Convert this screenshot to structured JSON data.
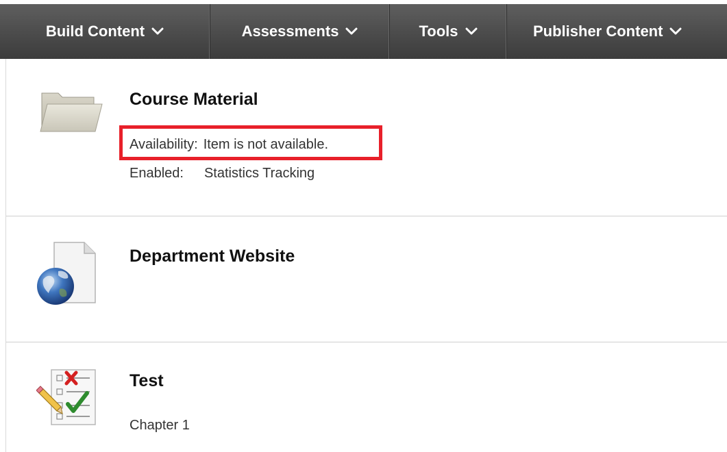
{
  "toolbar": {
    "items": [
      {
        "label": "Build Content"
      },
      {
        "label": "Assessments"
      },
      {
        "label": "Tools"
      },
      {
        "label": "Publisher Content"
      }
    ]
  },
  "content_items": [
    {
      "title": "Course Material",
      "icon": "folder-icon",
      "availability_label": "Availability:",
      "availability_value": "Item is not available.",
      "enabled_label": "Enabled:",
      "enabled_value": "Statistics Tracking"
    },
    {
      "title": "Department Website",
      "icon": "web-link-globe-icon"
    },
    {
      "title": "Test",
      "icon": "test-checklist-icon",
      "description": "Chapter 1"
    }
  ],
  "colors": {
    "toolbar_bg": "#4b4b4b",
    "highlight": "#e8202a"
  }
}
